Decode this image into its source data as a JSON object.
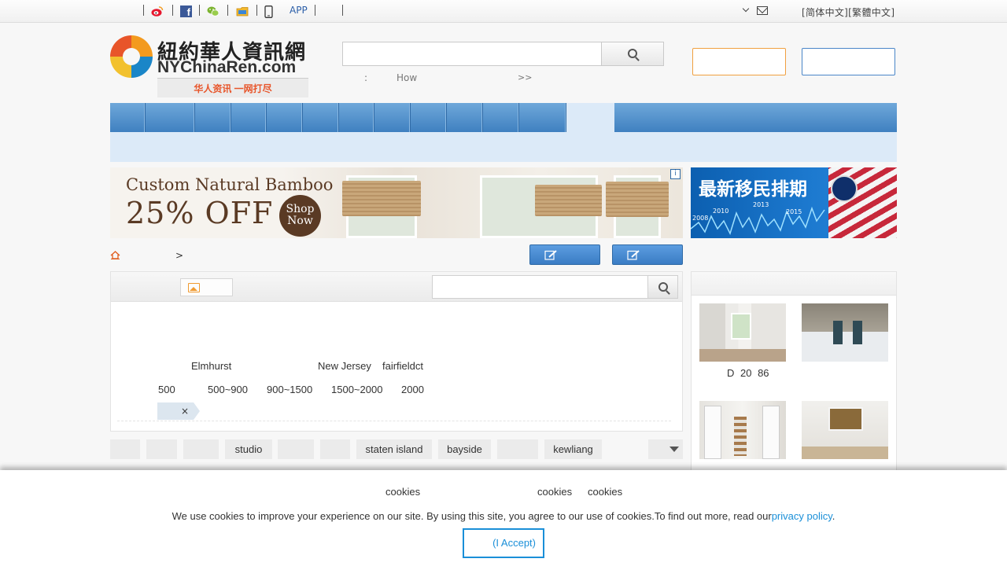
{
  "topbar": {
    "app_label": "APP",
    "language_links": "[简体中文][繁體中文]",
    "icons": [
      "weibo-icon",
      "facebook-icon",
      "wechat-icon",
      "folder-icon",
      "mobile-icon",
      "chevron-down-icon",
      "mail-icon"
    ]
  },
  "logo": {
    "chinese_name": "紐約華人資訊網",
    "english_name": "NYChinaRen.com",
    "slogan": "华人资讯 一网打尽"
  },
  "search": {
    "placeholder": "",
    "hot_prefix": ":",
    "hot_keyword": "How",
    "more": ">>"
  },
  "header_buttons": {
    "orange_label": "",
    "blue_label": ""
  },
  "ads": {
    "left": {
      "line1": "Custom Natural Bamboo",
      "line2": "25% OFF",
      "badge": "Shop Now",
      "info": "i"
    },
    "right": {
      "title": "最新移民排期",
      "years": [
        "2008",
        "2010",
        "2013",
        "2015"
      ]
    }
  },
  "breadcrumb": {
    "separator": ">"
  },
  "listing": {
    "search_placeholder": "",
    "filters_area": [
      "Elmhurst",
      "New Jersey",
      "fairfieldct"
    ],
    "filters_price": [
      "500",
      "500~900",
      "900~1500",
      "1500~2000",
      "2000"
    ],
    "selected_chip_close": "×"
  },
  "tags": [
    "",
    "",
    "",
    "studio",
    "",
    "",
    "staten island",
    "bayside",
    "",
    "kewliang"
  ],
  "sidebar": {
    "caption": "D 20 86"
  },
  "cookie": {
    "labels": [
      "cookies",
      "cookies",
      "cookies"
    ],
    "message": "We use cookies to improve your experience on our site. By using this site, you agree to our use of cookies.To find out more, read our",
    "policy_link": "privacy policy",
    "period": ".",
    "accept": "(I Accept)"
  },
  "colors": {
    "nav_blue": "#4a8ccb",
    "accent_orange": "#f0a040",
    "link_blue": "#1a8fd8"
  }
}
